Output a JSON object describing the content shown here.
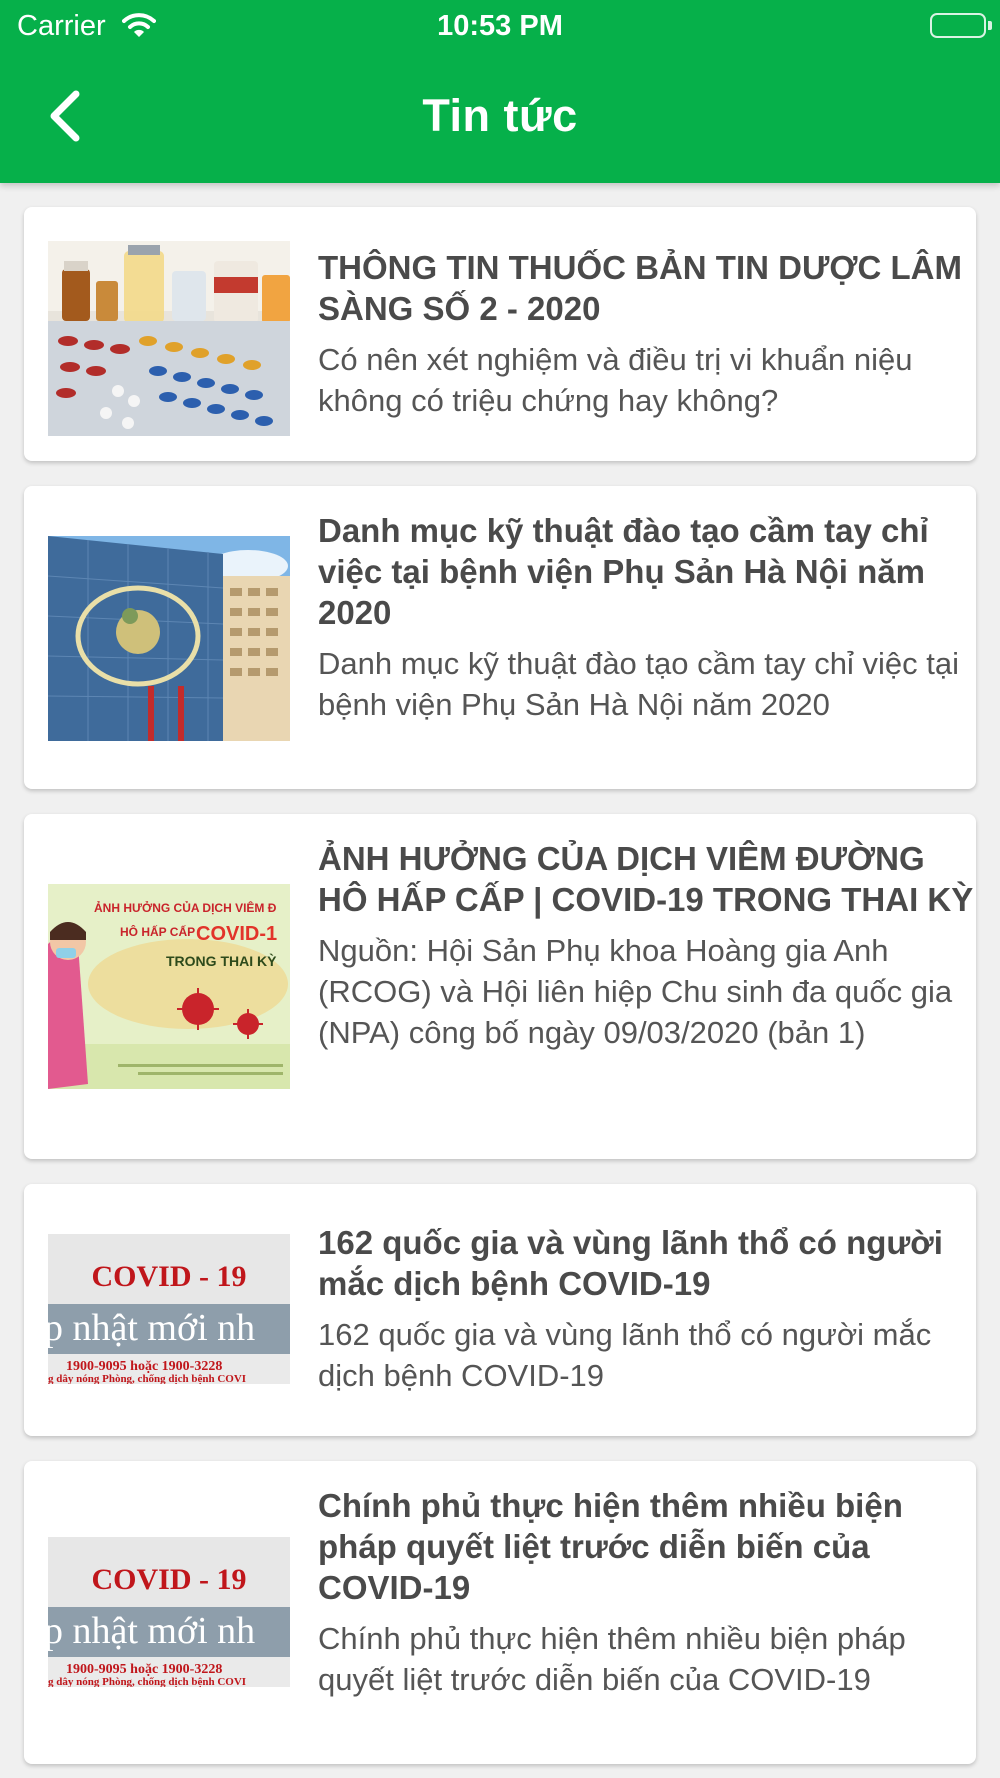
{
  "status_bar": {
    "carrier": "Carrier",
    "time": "10:53 PM"
  },
  "nav": {
    "title": "Tin tức",
    "back_icon": "chevron-left-icon"
  },
  "colors": {
    "header": "#06b04a",
    "background": "#f0f0f0",
    "text": "#4a4a4a"
  },
  "news": [
    {
      "title": "THÔNG TIN THUỐC BẢN TIN DƯỢC LÂM SÀNG SỐ 2 - 2020",
      "description": "Có nên xét nghiệm và điều trị vi khuẩn niệu không có triệu chứng hay không?",
      "image": "medicine-pills-image"
    },
    {
      "title": "Danh mục kỹ thuật đào tạo cầm tay chỉ việc tại bệnh viện Phụ Sản Hà Nội năm 2020",
      "description": "Danh mục kỹ thuật đào tạo cầm tay chỉ việc tại bệnh viện Phụ Sản Hà Nội năm 2020",
      "image": "hospital-building-image"
    },
    {
      "title": "ẢNH HƯỞNG CỦA DỊCH VIÊM ĐƯỜNG HÔ HẤP CẤP | COVID-19 TRONG THAI KỲ",
      "description": "Nguồn: Hội Sản Phụ khoa Hoàng gia Anh (RCOG) và Hội liên hiệp Chu sinh đa quốc gia (NPA) công bố ngày 09/03/2020 (bản 1)",
      "image": "covid-pregnancy-image",
      "image_text": {
        "line1": "ẢNH HƯỞNG CỦA DỊCH VIÊM Đ",
        "line2": "HÔ HẤP CẤP",
        "line3": "COVID-1",
        "line4": "TRONG THAI KỲ"
      }
    },
    {
      "title": "162 quốc gia và vùng lãnh thổ có người mắc dịch bệnh COVID-19",
      "description": "162 quốc gia và vùng lãnh thổ có người mắc dịch bệnh COVID-19",
      "image": "covid-hotline-image",
      "image_text": {
        "line1": "COVID - 19",
        "line2": "p nhật mới nh",
        "line3": "1900-9095 hoặc 1900-3228",
        "line4": "g dây nóng Phòng, chống dịch bệnh COVI"
      }
    },
    {
      "title": "Chính phủ thực hiện thêm nhiều biện pháp quyết liệt trước diễn biến của COVID-19",
      "description": "Chính phủ thực hiện thêm nhiều biện pháp quyết liệt trước diễn biến của COVID-19",
      "image": "covid-hotline-image",
      "image_text": {
        "line1": "COVID - 19",
        "line2": "p nhật mới nh",
        "line3": "1900-9095 hoặc 1900-3228",
        "line4": "g dây nóng Phòng, chống dịch bệnh COVI"
      }
    }
  ]
}
